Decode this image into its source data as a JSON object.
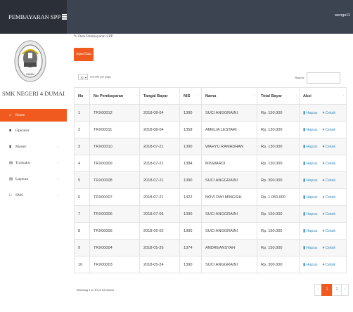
{
  "app": {
    "title": "PEMBAYARAN SPP",
    "user": "wengo11"
  },
  "sidebar": {
    "school_name": "SMK NEGERI 4 DUMAI",
    "logo_text": "DUMAI",
    "items": [
      {
        "label": "Home",
        "icon": "home-icon",
        "active": true
      },
      {
        "label": "Operator",
        "icon": "user-icon"
      },
      {
        "label": "Master",
        "icon": "book-icon",
        "chevron": "‹"
      },
      {
        "label": "Transaksi",
        "icon": "money-icon",
        "chevron": "‹"
      },
      {
        "label": "Laporan",
        "icon": "chart-icon",
        "chevron": "‹"
      },
      {
        "label": "SMS",
        "icon": "sms-icon",
        "chevron": "‹"
      }
    ]
  },
  "main": {
    "breadcrumb": "Data Pembayaran SPP",
    "input_button": "Input Data",
    "length_value": "10",
    "length_label": "records per page",
    "search_label": "Search:",
    "search_value": "",
    "columns": [
      "No",
      "No Pembayaran",
      "Tangal Bayar",
      "NIS",
      "Nama",
      "Total Bayar",
      "Aksi"
    ],
    "rows": [
      [
        "1",
        "TRX00012",
        "2018-08-04",
        "1390",
        "SUCI ANGGRAINI",
        "Rp. 150.000"
      ],
      [
        "2",
        "TRX00011",
        "2018-08-04",
        "1358",
        "AMELIA LESTARI",
        "Rp. 130.000"
      ],
      [
        "3",
        "TRX00010",
        "2018-07-21",
        "1390",
        "WAHYU RAMADHAN",
        "Rp. 130.000"
      ],
      [
        "4",
        "TRX00009",
        "2018-07-21",
        "1384",
        "MISWARDI",
        "Rp. 130.000"
      ],
      [
        "5",
        "TRX00008",
        "2018-07-21",
        "1390",
        "SUCI ANGGRAINI",
        "Rp. 300.000"
      ],
      [
        "6",
        "TRX00007",
        "2018-07-21",
        "1422",
        "NOVI DWI MINGSIH",
        "Rp. 1.050.000"
      ],
      [
        "7",
        "TRX00006",
        "2018-07-06",
        "1390",
        "SUCI ANGGRAINI",
        "Rp. 150.000"
      ],
      [
        "8",
        "TRX00005",
        "2018-06-02",
        "1390",
        "SUCI ANGGRAINI",
        "Rp. 150.000"
      ],
      [
        "9",
        "TRX00004",
        "2018-05-26",
        "1374",
        "ANDREANSYAH",
        "Rp. 150.000"
      ],
      [
        "10",
        "TRX00003",
        "2018-05-24",
        "1390",
        "SUCI ANGGRAINI",
        "Rp. 300.000"
      ]
    ],
    "action_hapus": "Hapus",
    "action_cetak": "Cetak",
    "info": "Showing 1 to 10 of 12 entries",
    "pagination": {
      "prev": "‹",
      "page1": "1",
      "page2": "2",
      "next": "›"
    }
  },
  "colors": {
    "accent": "#f05a1f",
    "topbar": "#3c4452",
    "link": "#3c8dbc"
  }
}
